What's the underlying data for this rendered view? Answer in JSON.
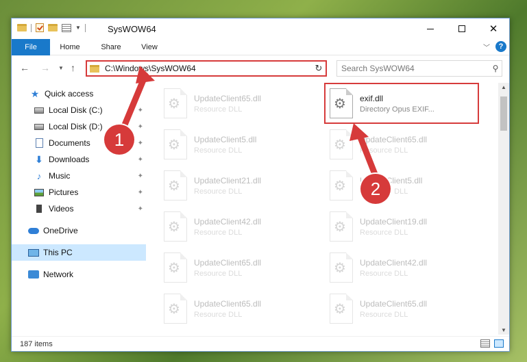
{
  "window": {
    "title": "SysWOW64"
  },
  "ribbon": {
    "tabs": [
      "File",
      "Home",
      "Share",
      "View"
    ]
  },
  "address": {
    "path": "C:\\Windows\\SysWOW64"
  },
  "search": {
    "placeholder": "Search SysWOW64"
  },
  "sidebar": {
    "items": [
      {
        "label": "Quick access"
      },
      {
        "label": "Local Disk (C:)"
      },
      {
        "label": "Local Disk (D:)"
      },
      {
        "label": "Documents"
      },
      {
        "label": "Downloads"
      },
      {
        "label": "Music"
      },
      {
        "label": "Pictures"
      },
      {
        "label": "Videos"
      },
      {
        "label": "OneDrive"
      },
      {
        "label": "This PC"
      },
      {
        "label": "Network"
      }
    ]
  },
  "files": {
    "left": [
      {
        "name": "UpdateClient65.dll",
        "type": "Resource DLL"
      },
      {
        "name": "UpdateClient5.dll",
        "type": "Resource DLL"
      },
      {
        "name": "UpdateClient21.dll",
        "type": "Resource DLL"
      },
      {
        "name": "UpdateClient42.dll",
        "type": "Resource DLL"
      },
      {
        "name": "UpdateClient65.dll",
        "type": "Resource DLL"
      },
      {
        "name": "UpdateClient65.dll",
        "type": "Resource DLL"
      }
    ],
    "right": [
      {
        "name": "exif.dll",
        "type": "Directory Opus EXIF..."
      },
      {
        "name": "UpdateClient65.dll",
        "type": "Resource DLL"
      },
      {
        "name": "UpdateClient5.dll",
        "type": "Resource DLL"
      },
      {
        "name": "UpdateClient19.dll",
        "type": "Resource DLL"
      },
      {
        "name": "UpdateClient42.dll",
        "type": "Resource DLL"
      },
      {
        "name": "UpdateClient65.dll",
        "type": "Resource DLL"
      }
    ]
  },
  "status": {
    "count": "187 items"
  },
  "annotations": {
    "step1": "1",
    "step2": "2"
  },
  "colors": {
    "accent": "#1979ca",
    "highlight": "#d63a3a"
  }
}
